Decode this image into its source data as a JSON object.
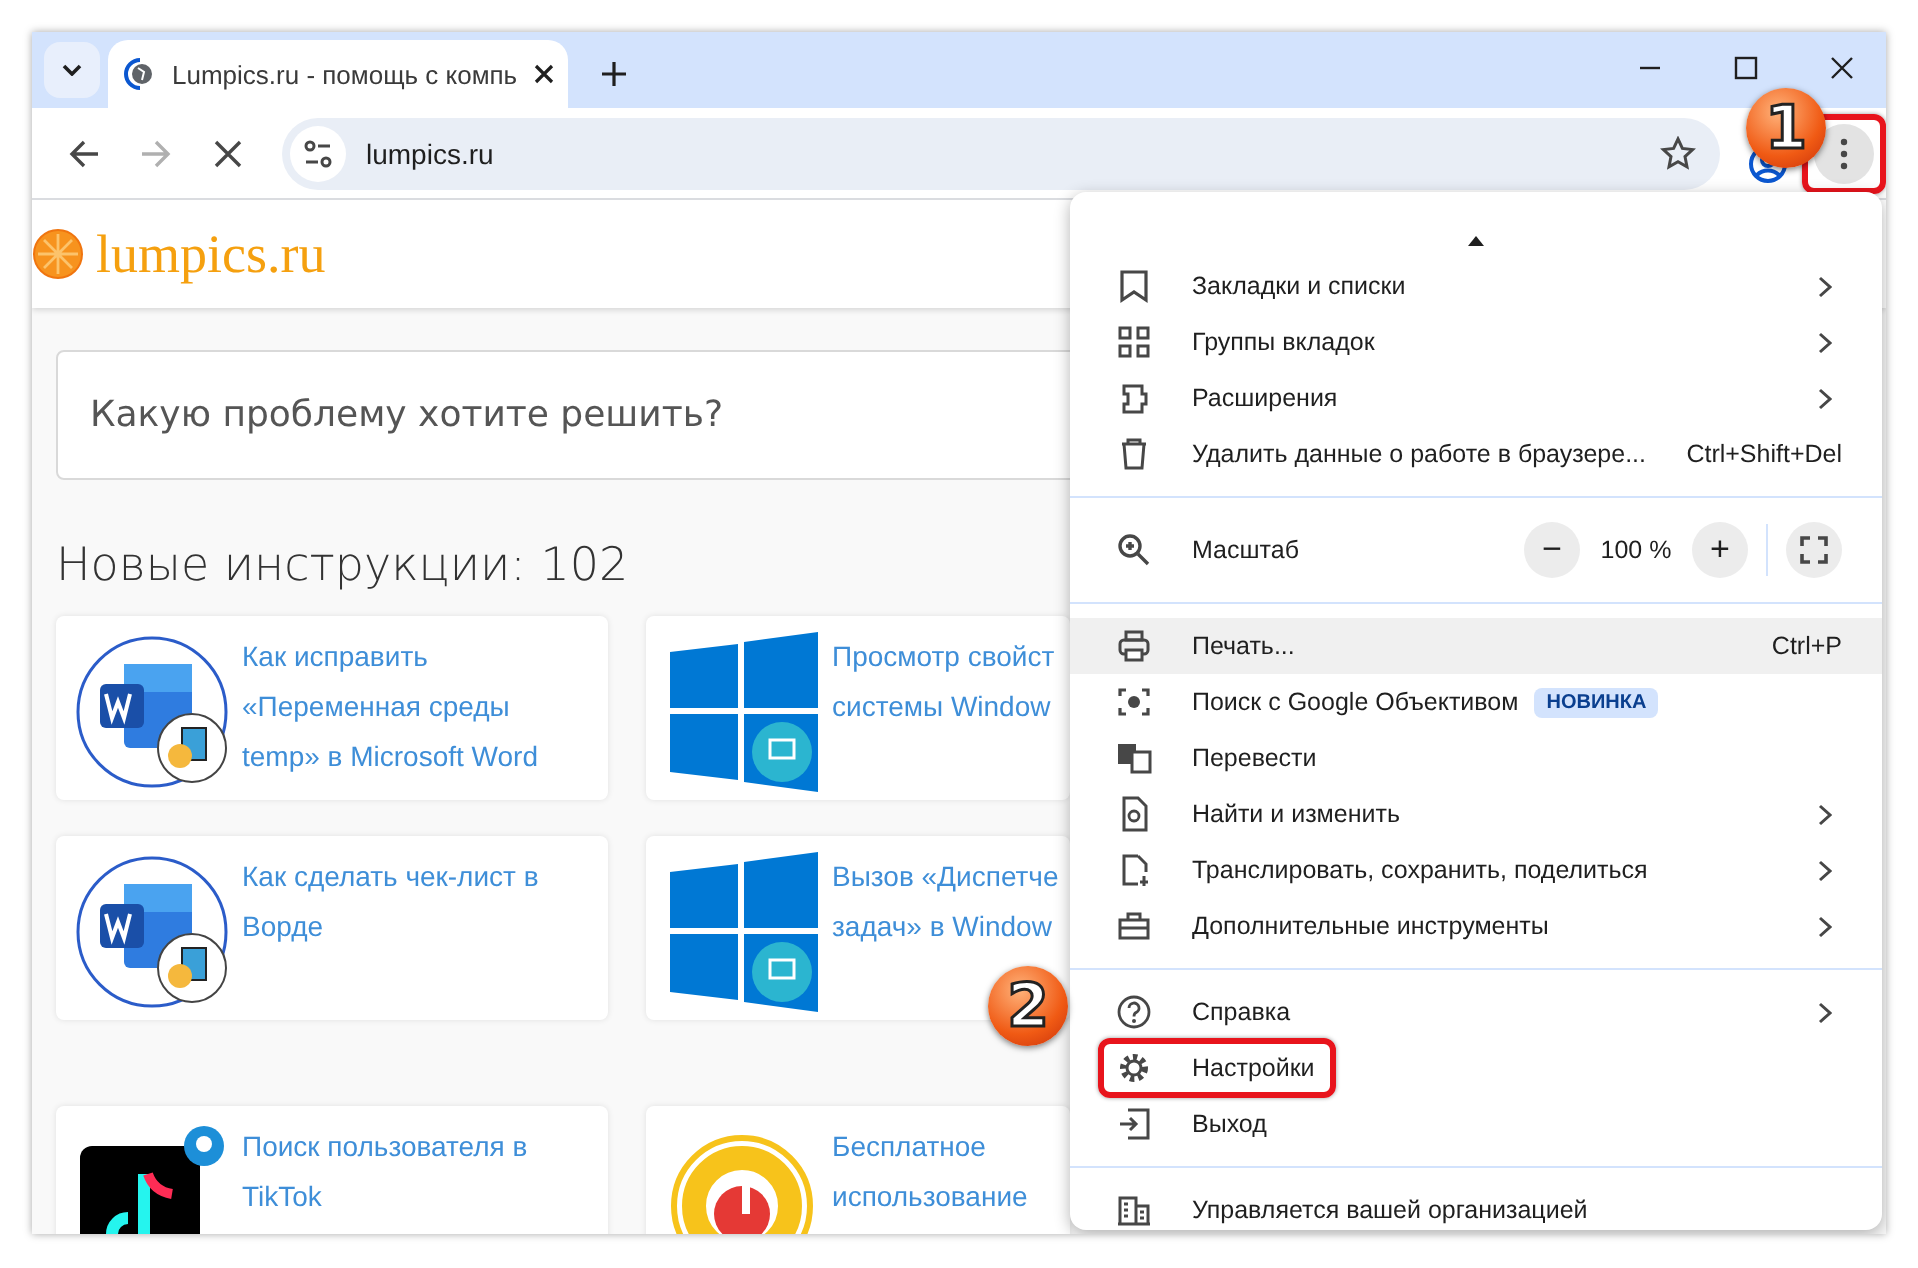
{
  "tabs": [
    {
      "title": "Lumpics.ru - помощь с компь",
      "selected": true
    }
  ],
  "address": {
    "value": "lumpics.ru"
  },
  "menu_button": {
    "framed": true
  },
  "site": {
    "logo": "lumpics.ru",
    "search_placeholder": "Какую проблему хотите решить?",
    "heading": "Новые инструкции: 102"
  },
  "cards": [
    {
      "title": "Как исправить «Переменная среды temp» в Microsoft Word",
      "kind": "document"
    },
    {
      "title": "Просмотр свойст системы Window",
      "kind": "tiles"
    },
    {
      "title": "Как сделать чек-лист в Ворде",
      "kind": "document"
    },
    {
      "title": "Вызов «Диспетче задач» в Window",
      "kind": "tiles"
    },
    {
      "title": "Поиск пользователя в TikTok",
      "kind": "note-dark"
    },
    {
      "title": "Бесплатное использование",
      "kind": "note-ring"
    }
  ],
  "menu": {
    "items": [
      {
        "kind": "item",
        "label": "Закладки и списки",
        "submenu": true,
        "highlighted": false,
        "framed": false
      },
      {
        "kind": "item",
        "label": "Группы вкладок",
        "submenu": true,
        "highlighted": false,
        "framed": false
      },
      {
        "kind": "item",
        "label": "Расширения",
        "submenu": true,
        "highlighted": false,
        "framed": false
      },
      {
        "kind": "item",
        "label": "Удалить данные о работе в браузере...",
        "shortcut": "Ctrl+Shift+Del",
        "submenu": false,
        "highlighted": false,
        "framed": false
      },
      {
        "kind": "separator"
      },
      {
        "kind": "zoom",
        "label": "Масштаб",
        "minus": "−",
        "value": "100 %",
        "plus": "+"
      },
      {
        "kind": "separator"
      },
      {
        "kind": "item",
        "label": "Печать...",
        "shortcut": "Ctrl+P",
        "submenu": false,
        "highlighted": true,
        "framed": false
      },
      {
        "kind": "item",
        "label": "Поиск с Google Объективом",
        "badge": "НОВИНКА",
        "submenu": false,
        "highlighted": false,
        "framed": false
      },
      {
        "kind": "item",
        "label": "Перевести",
        "submenu": false,
        "highlighted": false,
        "framed": false
      },
      {
        "kind": "item",
        "label": "Найти и изменить",
        "submenu": true,
        "highlighted": false,
        "framed": false
      },
      {
        "kind": "item",
        "label": "Транслировать, сохранить, поделиться",
        "submenu": true,
        "highlighted": false,
        "framed": false
      },
      {
        "kind": "item",
        "label": "Дополнительные инструменты",
        "submenu": true,
        "highlighted": false,
        "framed": false
      },
      {
        "kind": "separator"
      },
      {
        "kind": "item",
        "label": "Справка",
        "submenu": true,
        "highlighted": false,
        "framed": false
      },
      {
        "kind": "item",
        "label": "Настройки",
        "submenu": false,
        "highlighted": false,
        "framed": true
      },
      {
        "kind": "item",
        "label": "Выход",
        "submenu": false,
        "highlighted": false,
        "framed": false
      },
      {
        "kind": "separator"
      },
      {
        "kind": "item",
        "label": "Управляется вашей организацией",
        "submenu": false,
        "highlighted": false,
        "framed": false
      }
    ]
  },
  "annotations": [
    {
      "label": "1"
    },
    {
      "label": "2"
    }
  ]
}
